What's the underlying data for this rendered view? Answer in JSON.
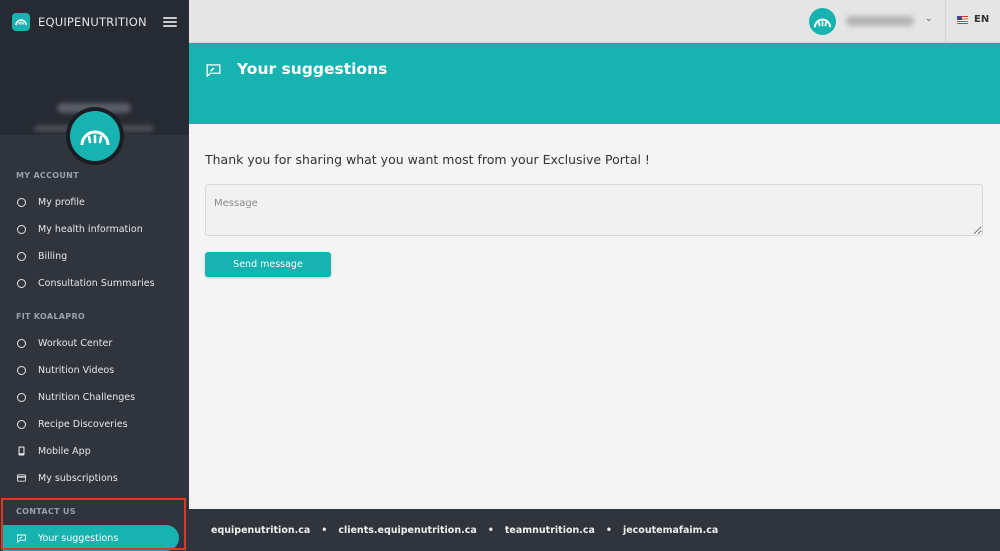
{
  "brand": {
    "name": "EQUIPENUTRITION"
  },
  "sidebar": {
    "sections": [
      {
        "title": "MY ACCOUNT"
      },
      {
        "title": "FIT KOALAPRO"
      },
      {
        "title": "CONTACT US"
      }
    ],
    "items": [
      {
        "label": "My profile",
        "icon": "circle-icon"
      },
      {
        "label": "My health information",
        "icon": "circle-icon"
      },
      {
        "label": "Billing",
        "icon": "circle-icon"
      },
      {
        "label": "Consultation Summaries",
        "icon": "circle-icon"
      },
      {
        "label": "Workout Center",
        "icon": "circle-icon"
      },
      {
        "label": "Nutrition Videos",
        "icon": "circle-icon"
      },
      {
        "label": "Nutrition Challenges",
        "icon": "circle-icon"
      },
      {
        "label": "Recipe Discoveries",
        "icon": "circle-icon"
      },
      {
        "label": "Mobile App",
        "icon": "mobile-phone-icon"
      },
      {
        "label": "My subscriptions",
        "icon": "card-icon"
      },
      {
        "label": "Your suggestions",
        "icon": "feedback-icon",
        "active": true
      }
    ]
  },
  "topbar": {
    "language": "EN"
  },
  "page": {
    "title": "Your suggestions",
    "intro": "Thank you for sharing what you want most from your Exclusive Portal !",
    "message_placeholder": "Message",
    "send_label": "Send message"
  },
  "footer": {
    "links": [
      "equipenutrition.ca",
      "clients.equipenutrition.ca",
      "teamnutrition.ca",
      "jecoutemafaim.ca"
    ],
    "separator": "•"
  },
  "colors": {
    "accent": "#16b3b1",
    "sidebar": "#30343d",
    "highlight": "#e0371f"
  }
}
